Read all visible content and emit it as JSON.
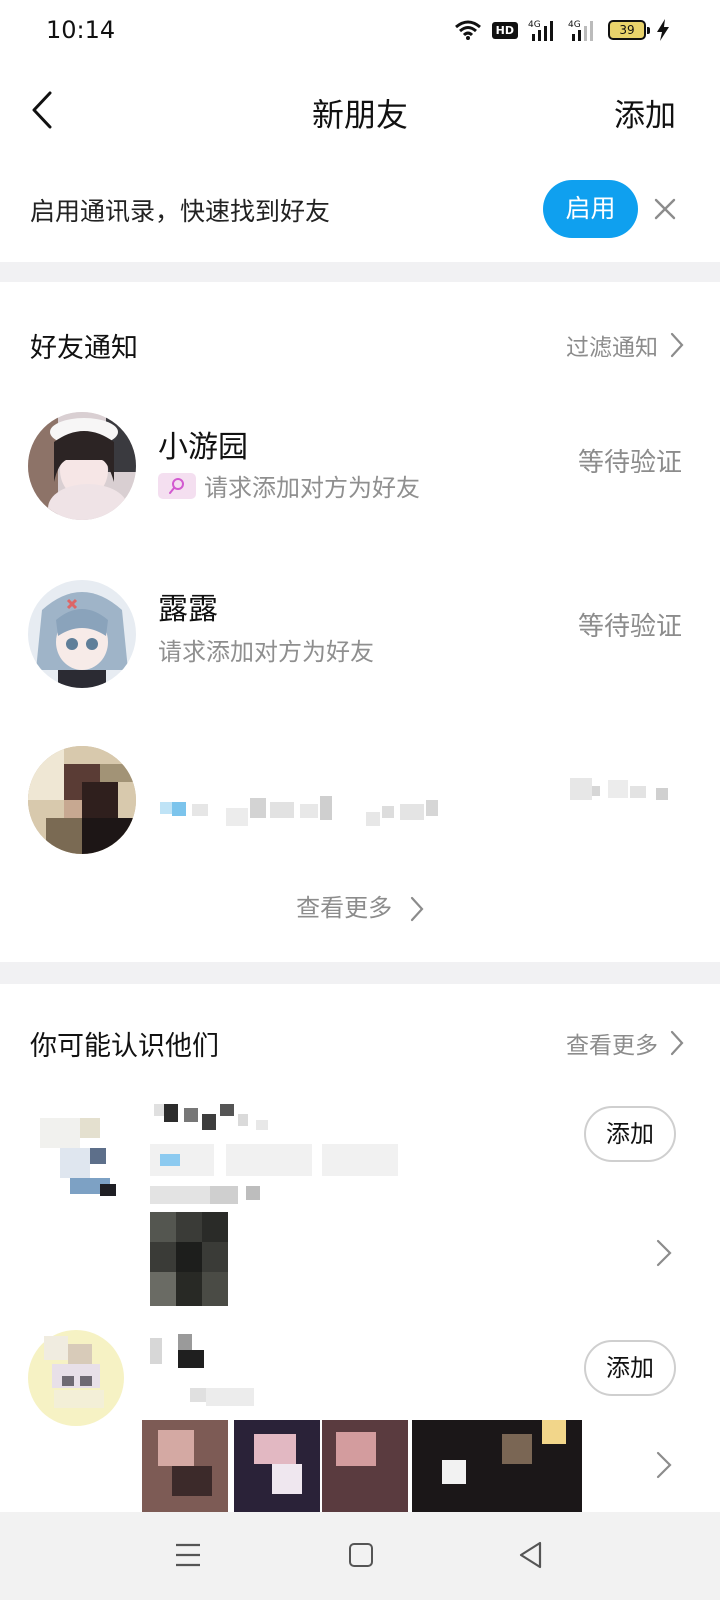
{
  "status_bar": {
    "time": "10:14",
    "hd_label": "HD",
    "network_1": "4G",
    "network_2": "4G",
    "battery": "39"
  },
  "nav": {
    "back_icon": "chevron-left-icon",
    "title": "新朋友",
    "add_label": "添加"
  },
  "contacts_banner": {
    "text": "启用通讯录，快速找到好友",
    "enable_label": "启用",
    "close_icon": "close-icon"
  },
  "friend_notifications": {
    "title": "好友通知",
    "filter_label": "过滤通知",
    "items": [
      {
        "name": "小游园",
        "message": "请求添加对方为好友",
        "status": "等待验证",
        "has_search_tag": true
      },
      {
        "name": "露露",
        "message": "请求添加对方为好友",
        "status": "等待验证",
        "has_search_tag": false
      },
      {
        "name": "",
        "message": "",
        "status": "",
        "redacted": true
      }
    ],
    "see_more_label": "查看更多"
  },
  "people_you_may_know": {
    "title": "你可能认识他们",
    "see_more_label": "查看更多",
    "items": [
      {
        "redacted": true,
        "add_label": "添加"
      },
      {
        "redacted": true,
        "add_label": "添加"
      }
    ]
  },
  "colors": {
    "accent": "#0fa0ef",
    "secondary_text": "#8c8c8c",
    "divider": "#f1f1f3"
  }
}
